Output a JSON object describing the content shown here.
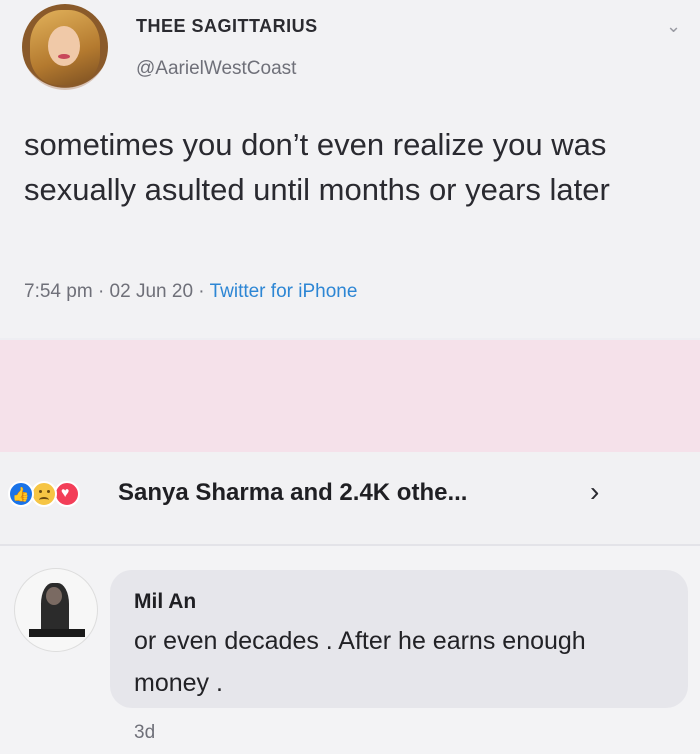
{
  "tweet": {
    "display_name": "THEE SAGITTARIUS",
    "handle": "@AarielWestCoast",
    "text": "sometimes you don’t even realize you was sexually asulted until months or years later",
    "time": "7:54 pm",
    "date": "02 Jun 20",
    "source": "Twitter for iPhone",
    "separator": "·"
  },
  "reactions": {
    "summary": "Sanya Sharma and 2.4K othe...",
    "icons": [
      "like-icon",
      "sad-icon",
      "love-icon"
    ]
  },
  "comment": {
    "author": "Mil An",
    "text": "or even decades . After he earns enough money .",
    "age": "3d"
  },
  "colors": {
    "link_blue": "#2d86d4",
    "pink_band": "#f5e1ea",
    "like_blue": "#1a73e8",
    "love_red": "#f33e58",
    "sad_yellow": "#f6c544"
  }
}
